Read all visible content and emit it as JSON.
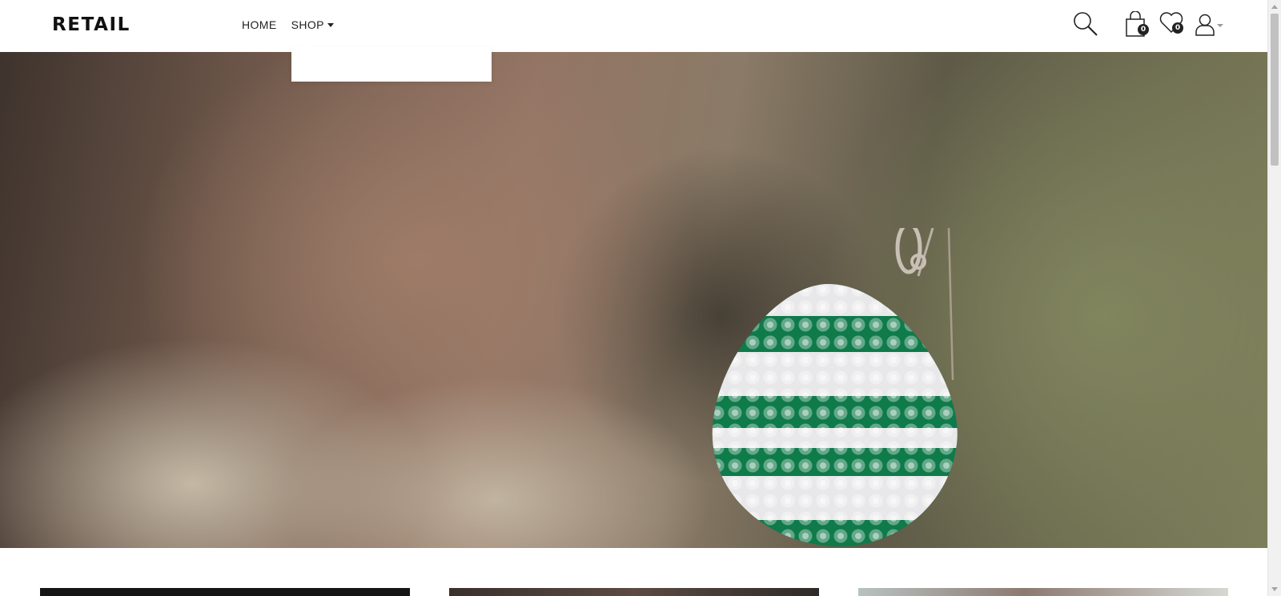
{
  "brand": {
    "logo": "RETAIL"
  },
  "nav": {
    "items": [
      {
        "label": "HOME"
      },
      {
        "label": "SHOP"
      }
    ]
  },
  "header_icons": {
    "search": {
      "icon": "search-icon"
    },
    "cart": {
      "icon": "shopping-bag-icon",
      "count": "0"
    },
    "wishlist": {
      "icon": "heart-icon",
      "count": "0"
    },
    "account": {
      "icon": "user-icon"
    }
  },
  "slider": {
    "slide_count": 2,
    "active_index": 0
  },
  "colors": {
    "text": "#111111",
    "badge": "#222222",
    "pendant_green": "#0f7a4a",
    "pendant_crystal": "#e8e8ea"
  }
}
